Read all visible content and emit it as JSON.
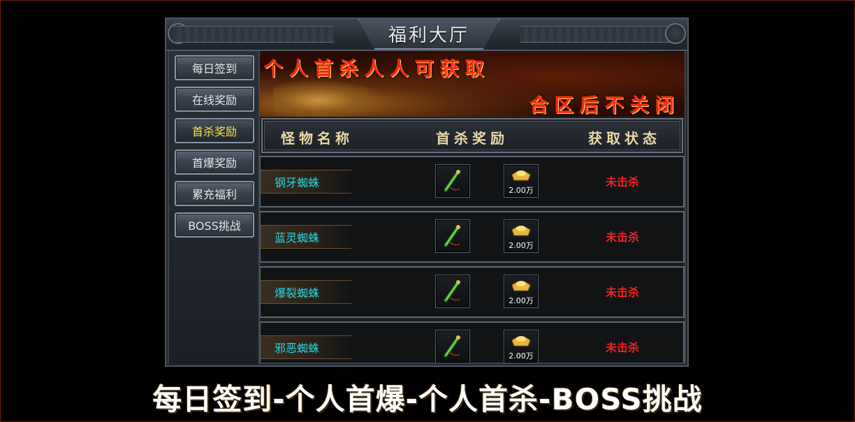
{
  "window": {
    "title": "福利大厅"
  },
  "sidebar": {
    "items": [
      {
        "label": "每日签到",
        "active": false
      },
      {
        "label": "在线奖励",
        "active": false
      },
      {
        "label": "首杀奖励",
        "active": true
      },
      {
        "label": "首爆奖励",
        "active": false
      },
      {
        "label": "累充福利",
        "active": false
      },
      {
        "label": "BOSS挑战",
        "active": false
      }
    ]
  },
  "banner": {
    "line1": "个人首杀人人可获取",
    "line2": "合区后不关闭"
  },
  "table": {
    "headers": {
      "name": "怪物名称",
      "reward": "首杀奖励",
      "status": "获取状态"
    },
    "rows": [
      {
        "name": "钢牙蜘蛛",
        "weapon_icon": "green-scepter-icon",
        "gold_icon": "gold-ingot-icon",
        "gold_amount": "2.00万",
        "status": "未击杀"
      },
      {
        "name": "蓝灵蜘蛛",
        "weapon_icon": "green-scepter-icon",
        "gold_icon": "gold-ingot-icon",
        "gold_amount": "2.00万",
        "status": "未击杀"
      },
      {
        "name": "爆裂蜘蛛",
        "weapon_icon": "green-scepter-icon",
        "gold_icon": "gold-ingot-icon",
        "gold_amount": "2.00万",
        "status": "未击杀"
      },
      {
        "name": "邪恶蜘蛛",
        "weapon_icon": "green-scepter-icon",
        "gold_icon": "gold-ingot-icon",
        "gold_amount": "2.00万",
        "status": "未击杀"
      }
    ]
  },
  "caption": "每日签到-个人首爆-个人首杀-BOSS挑战",
  "colors": {
    "monster_name": "#23d8e0",
    "status_unkilled": "#e22222",
    "active_tab": "#f4e54a",
    "banner_text": "#ff2a14"
  }
}
